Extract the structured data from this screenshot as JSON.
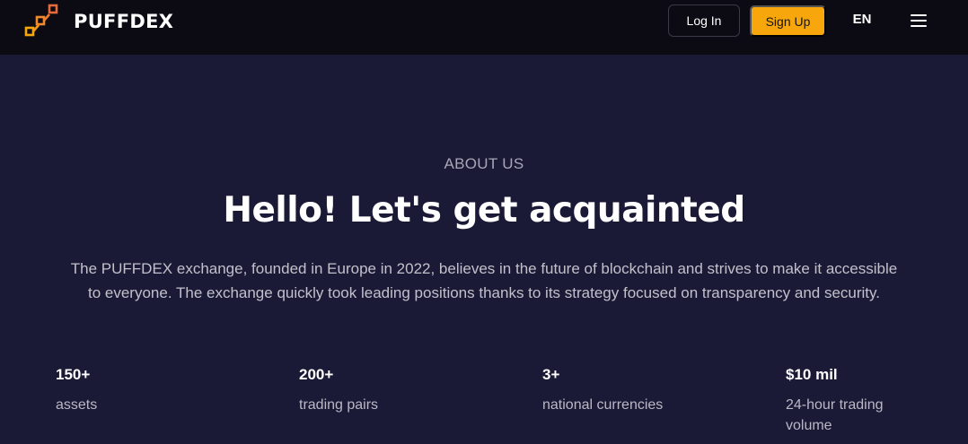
{
  "brand": {
    "name": "PUFFDEX",
    "logo_icon": "puffdex-logo-icon",
    "accent_color": "#f7a70c"
  },
  "nav": {
    "login_label": "Log In",
    "signup_label": "Sign Up",
    "language": "EN",
    "menu_icon": "hamburger-menu-icon"
  },
  "hero": {
    "eyebrow": "ABOUT US",
    "heading": "Hello! Let's get acquainted",
    "description": "The PUFFDEX exchange, founded in Europe in 2022, believes in the future of blockchain and strives to make it accessible to everyone. The exchange quickly took leading positions thanks to its strategy focused on transparency and security."
  },
  "stats": [
    {
      "value": "150+",
      "label": "assets"
    },
    {
      "value": "200+",
      "label": "trading pairs"
    },
    {
      "value": "3+",
      "label": "national currencies"
    },
    {
      "value": "$10 mil",
      "label": "24-hour trading volume"
    }
  ]
}
